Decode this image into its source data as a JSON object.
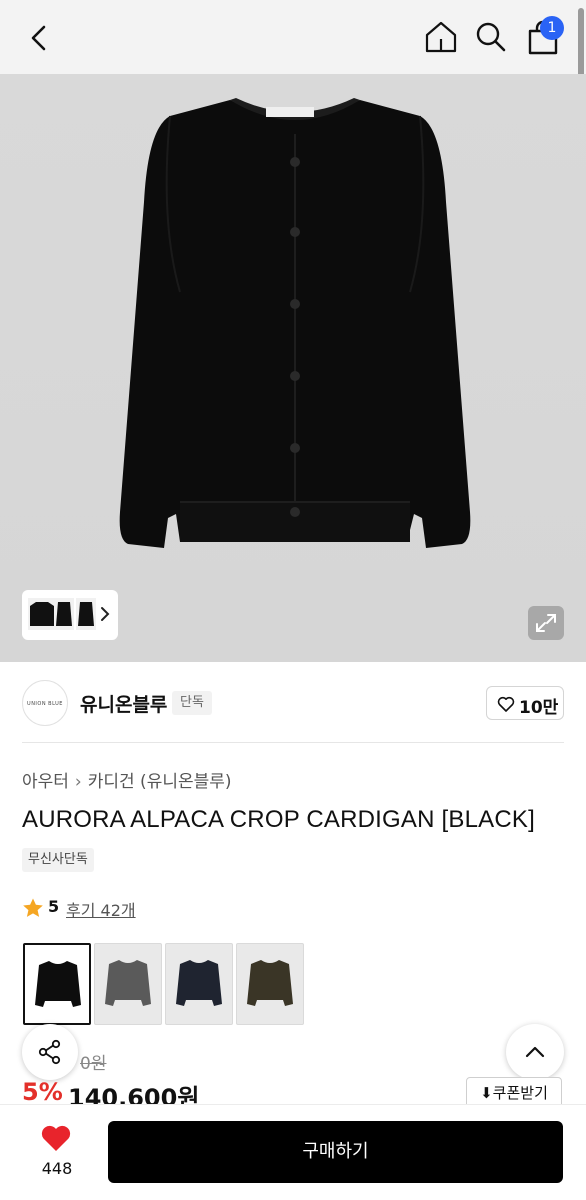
{
  "header": {
    "cart_count": "1",
    "back_icon": "chevron-left-icon",
    "home_icon": "home-icon",
    "search_icon": "search-icon",
    "cart_icon": "shopping-bag-icon",
    "badge_color": "#2a63f5"
  },
  "gallery": {
    "expand_icon": "expand-icon",
    "thumbnail_chevron_icon": "chevron-right-icon"
  },
  "brand": {
    "logo_text": "UNION BLUE",
    "name": "유니온블루",
    "badge": "단독",
    "like_label": "10만"
  },
  "breadcrumb": {
    "category": "아우터",
    "subcategory": "카디건 (유니온블루)"
  },
  "product": {
    "title": "AURORA ALPACA CROP CARDIGAN [BLACK]",
    "exclusive_tag": "무신사단독",
    "rating": "5",
    "reviews_label": "후기 42개",
    "original_price": "0원",
    "discount": "5%",
    "price": "140,600원",
    "coupon_label": "⬇쿠폰받기",
    "discount_color": "#e3302a",
    "star_color": "#f5a623"
  },
  "color_options": [
    {
      "name": "black",
      "color": "#0d0d0d",
      "selected": true
    },
    {
      "name": "gray",
      "color": "#5a5a5a",
      "selected": false
    },
    {
      "name": "navy",
      "color": "#1f2430",
      "selected": false
    },
    {
      "name": "khaki",
      "color": "#3a3526",
      "selected": false
    }
  ],
  "bottom_bar": {
    "like_count": "448",
    "buy_label": "구매하기",
    "heart_color": "#e8242c"
  }
}
